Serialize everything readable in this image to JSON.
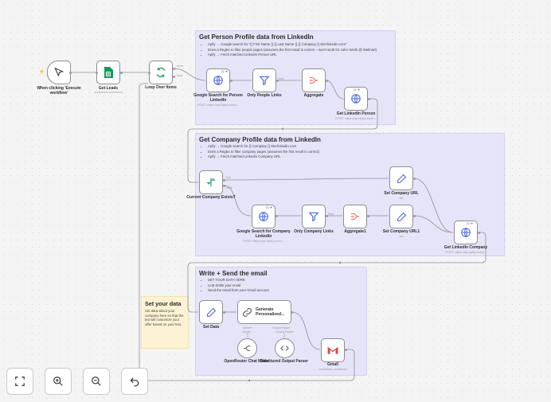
{
  "colors": {
    "accent": "#ff6d5a",
    "edge": "#8f8f96",
    "sticky_purple": "#e6e4f8",
    "sticky_yellow": "#fdf3d4",
    "gmail_red": "#ea4335"
  },
  "stickies": {
    "person": {
      "title": "Get Person Profile data from LinkedIn",
      "items": [
        "Apify → Google search for \"{{ First Name }} {{ Last Name }} {{ Company }} site:linkedin.com\"",
        "Does a RegEx to filter people pages (assumes the first result is correct – won't work for John Smith @ Walmart)",
        "Apify → Fetch matched LinkedIn Person URL"
      ]
    },
    "company": {
      "title": "Get Company Profile data from LinkedIn",
      "items": [
        "Apify → Google search for {{ Company }} site:linkedin.com",
        "Does a RegEx to filter company pages (assumes the first result is correct)",
        "Apify → Fetch matched LinkedIn Company URL"
      ]
    },
    "email": {
      "title": "Write + Send the email",
      "items": [
        "SET YOUR DATA HERE",
        "LLM drafts your email",
        "Send the email from your Gmail account"
      ]
    },
    "setyourdata": {
      "title": "Set your data",
      "body": "Set data about your company here so that the bot will customize your offer based on your text."
    }
  },
  "nodes": {
    "trigger": {
      "label": "When clicking 'Execute workflow'",
      "icon": "cursor-icon"
    },
    "getleads": {
      "label": "Get Leads",
      "sub": "undefined, undefined",
      "icon": "sheets-icon"
    },
    "loop": {
      "label": "Loop Over Items",
      "icon": "loop-icon",
      "out_done": "done",
      "out_loop": "loop"
    },
    "gsearch_person": {
      "label": "Google Search for Person LinkedIn",
      "sub": "POST: https://api.apify.com/v...",
      "icon": "globe-icon"
    },
    "only_people": {
      "label": "Only People Links",
      "icon": "filter-icon",
      "out": "Kept"
    },
    "aggregate": {
      "label": "Aggregate",
      "icon": "aggregate-icon"
    },
    "get_person": {
      "label": "Get LinkedIn Person",
      "sub": "POST: https://api.apify.com/v...",
      "icon": "globe-icon"
    },
    "company_exists": {
      "label": "Current Company Exists?",
      "icon": "if-icon",
      "out_true": "true",
      "out_false": "false"
    },
    "set_company_url": {
      "label": "Set Company URL",
      "sub": "set",
      "icon": "pen-icon"
    },
    "gsearch_company": {
      "label": "Google Search for Company LinkedIn",
      "sub": "POST: https://api.apify.com/v...",
      "icon": "globe-icon"
    },
    "only_company": {
      "label": "Only Company Links",
      "icon": "filter-icon",
      "out": "Kept"
    },
    "aggregate1": {
      "label": "Aggregate1",
      "icon": "aggregate-icon"
    },
    "set_company_url1": {
      "label": "Set Company URL1",
      "sub": "set",
      "icon": "pen-icon"
    },
    "get_company": {
      "label": "Get LinkedIn Company",
      "sub": "POST: https://api.apify.com/v...",
      "icon": "globe-icon"
    },
    "set_data": {
      "label": "Set Data",
      "icon": "pen-icon"
    },
    "generate": {
      "label": "Generate Personalized...",
      "icon": "link-icon",
      "port_model": "Model*",
      "port_parser": "Output Parser",
      "model_label": "Model",
      "parser_label": "Output Parser"
    },
    "openrouter": {
      "label": "OpenRouter Chat Model",
      "icon": "openrouter-icon"
    },
    "parser": {
      "label": "Structured Output Parser",
      "icon": "code-icon"
    },
    "gmail": {
      "label": "Gmail",
      "sub": "undefined, undefined",
      "icon": "gmail-icon"
    }
  },
  "controls": {
    "fit": "fit-view-icon",
    "zoom_in": "zoom-in-icon",
    "zoom_out": "zoom-out-icon",
    "undo": "undo-icon"
  }
}
